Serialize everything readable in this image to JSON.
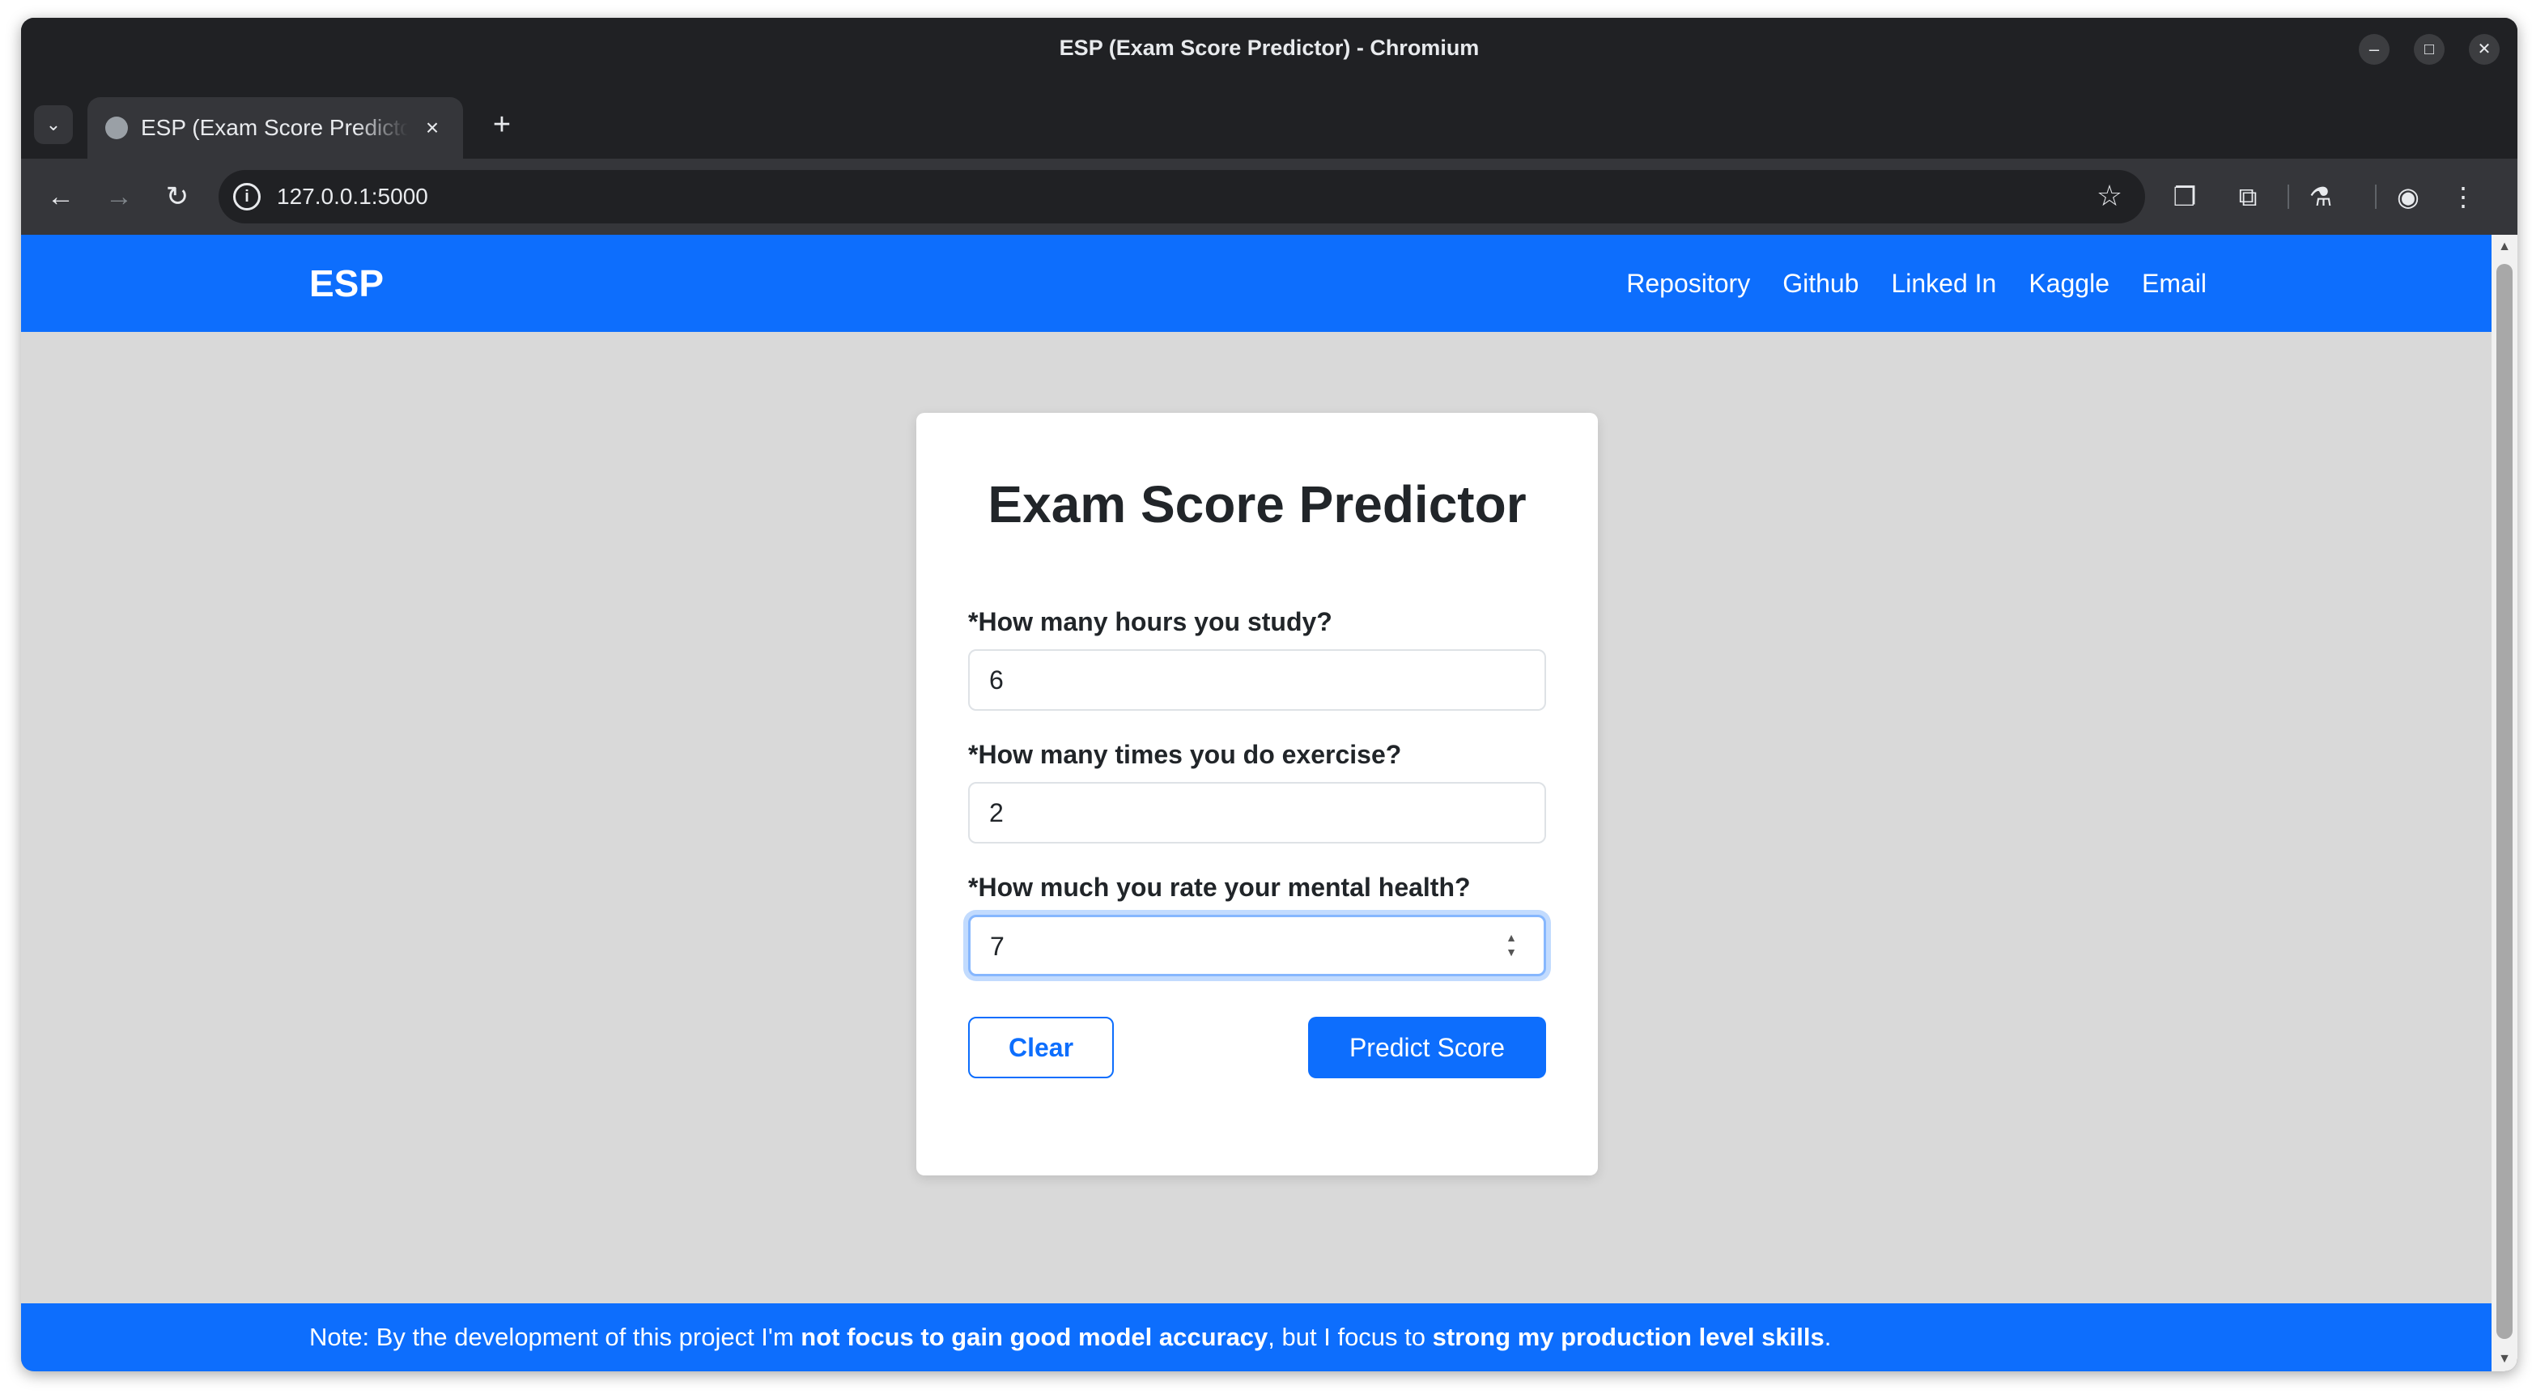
{
  "window": {
    "title": "ESP (Exam Score Predictor) - Chromium",
    "controls": {
      "minimize": "–",
      "maximize": "□",
      "close": "✕"
    }
  },
  "tabs": [
    {
      "title": "ESP (Exam Score Predictor)",
      "active": true
    }
  ],
  "toolbar": {
    "url": "127.0.0.1:5000",
    "icons": [
      "back-icon",
      "forward-icon",
      "reload-icon",
      "site-info-icon",
      "star-icon",
      "extension-puzzle-icon",
      "labs-flask-icon",
      "profile-icon",
      "menu-kebab-icon"
    ]
  },
  "navbar": {
    "brand": "ESP",
    "links": [
      "Repository",
      "Github",
      "Linked In",
      "Kaggle",
      "Email"
    ]
  },
  "form": {
    "title": "Exam Score Predictor",
    "fields": [
      {
        "label": "*How many hours you study?",
        "value": "6"
      },
      {
        "label": "*How many times you do exercise?",
        "value": "2"
      },
      {
        "label": "*How much you rate your mental health?",
        "value": "7"
      }
    ],
    "clear_label": "Clear",
    "submit_label": "Predict Score"
  },
  "footer": {
    "prefix": "Note: By the development of this project I'm ",
    "bold1": "not focus to gain good model accuracy",
    "middle": ", but I focus to ",
    "bold2": "strong my production level skills",
    "suffix": "."
  },
  "colors": {
    "primary": "#0d6efd",
    "page_background": "#d9d9d9",
    "browser_frame": "#202124"
  }
}
